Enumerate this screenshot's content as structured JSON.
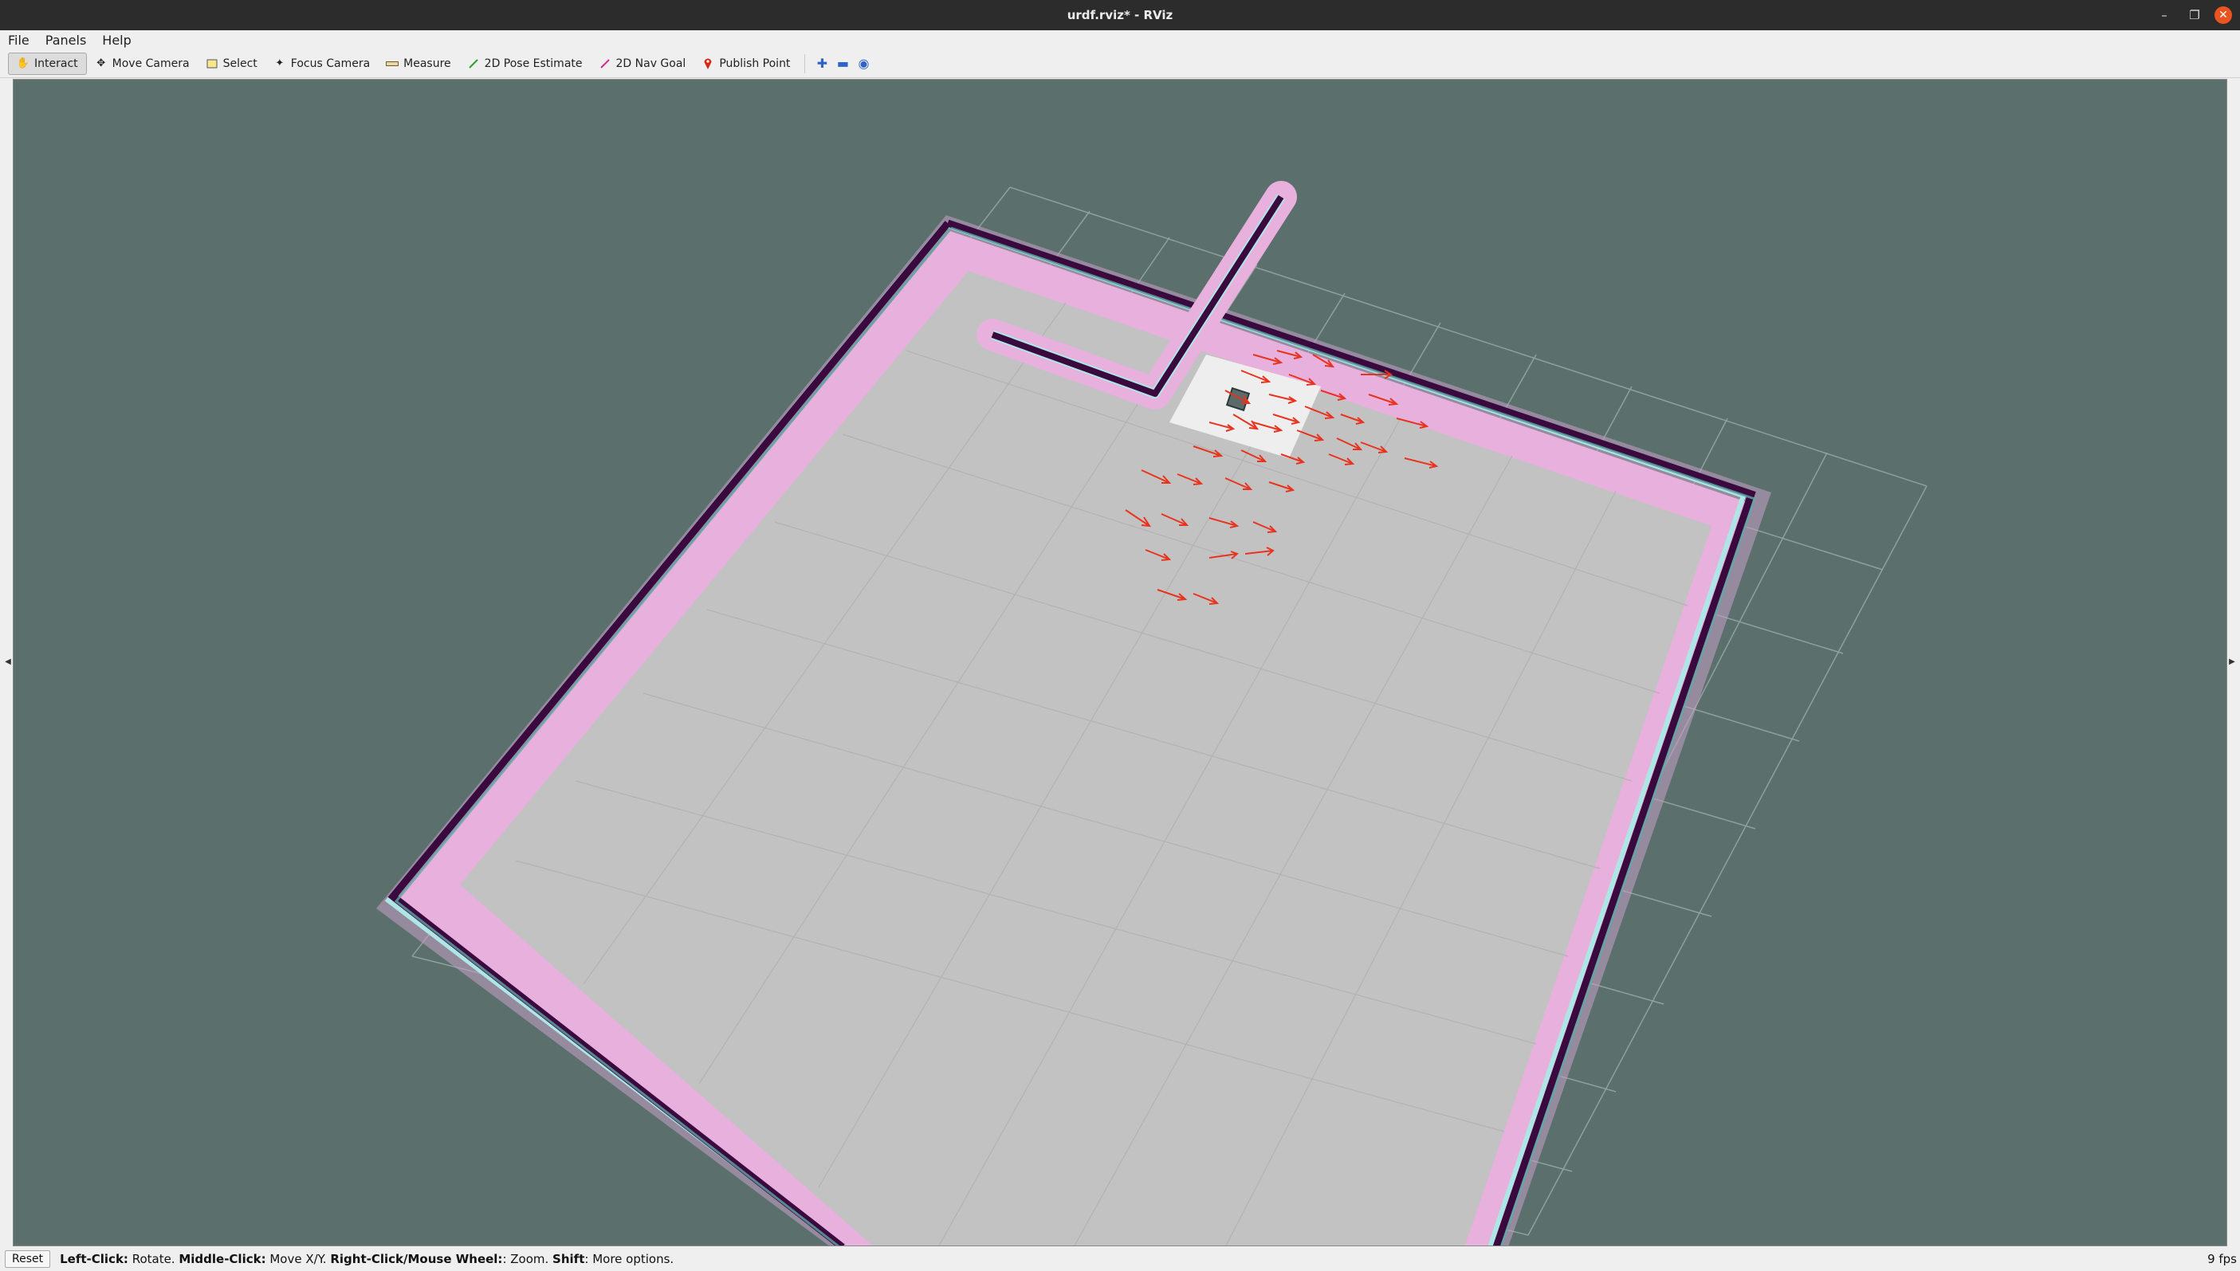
{
  "window": {
    "title": "urdf.rviz* - RViz",
    "controls": [
      "minimize",
      "restore",
      "close"
    ]
  },
  "menu": [
    "File",
    "Panels",
    "Help"
  ],
  "toolbar": {
    "tools": [
      {
        "label": "Interact",
        "icon": "hand-icon",
        "active": true
      },
      {
        "label": "Move Camera",
        "icon": "move-camera-icon",
        "active": false
      },
      {
        "label": "Select",
        "icon": "select-box-icon",
        "active": false
      },
      {
        "label": "Focus Camera",
        "icon": "focus-camera-icon",
        "active": false
      },
      {
        "label": "Measure",
        "icon": "ruler-icon",
        "active": false
      },
      {
        "label": "2D Pose Estimate",
        "icon": "green-arrow-icon",
        "active": false
      },
      {
        "label": "2D Nav Goal",
        "icon": "pink-arrow-icon",
        "active": false
      },
      {
        "label": "Publish Point",
        "icon": "red-pin-icon",
        "active": false
      }
    ],
    "extra_icons": [
      "add-tool-icon",
      "remove-tool-icon",
      "tool-properties-icon"
    ]
  },
  "colors": {
    "background": "#5b6f6d",
    "floor": "#c3c3c3",
    "wall": "#3a0a3e",
    "inflation": "#e3a5de",
    "inner_inflation": "#aee6e6",
    "particle_arrows": "#e8331e",
    "grid_lines": "#9aa9a7"
  },
  "status": {
    "reset_label": "Reset",
    "hint_parts": [
      {
        "bold": "Left-Click:",
        "text": " Rotate. "
      },
      {
        "bold": "Middle-Click:",
        "text": " Move X/Y. "
      },
      {
        "bold": "Right-Click/Mouse Wheel:",
        "text": ": Zoom. "
      },
      {
        "bold": "Shift",
        "text": ": More options."
      }
    ],
    "fps": "9 fps"
  }
}
